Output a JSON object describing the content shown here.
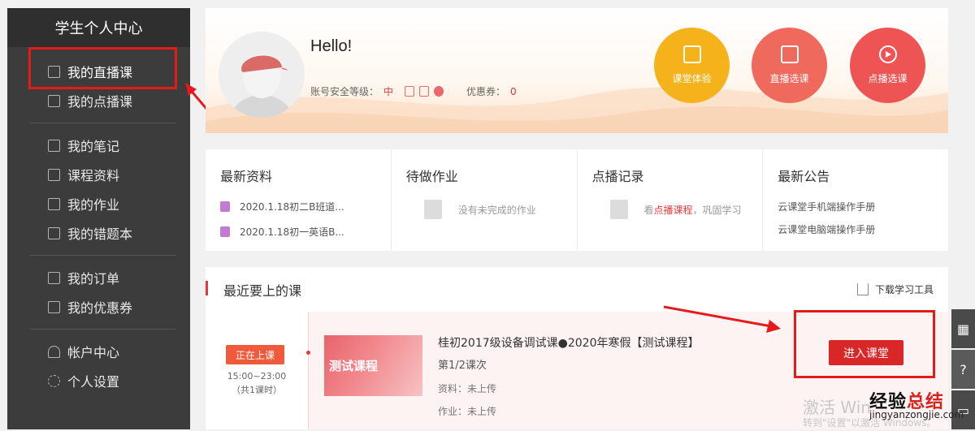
{
  "sidebar": {
    "title": "学生个人中心",
    "items": [
      {
        "label": "我的直播课",
        "icon": "calendar-icon"
      },
      {
        "label": "我的点播课",
        "icon": "video-icon"
      },
      {
        "label": "我的笔记",
        "icon": "pencil-icon"
      },
      {
        "label": "课程资料",
        "icon": "folder-icon"
      },
      {
        "label": "我的作业",
        "icon": "edit-icon"
      },
      {
        "label": "我的错题本",
        "icon": "notebook-icon"
      },
      {
        "label": "我的订单",
        "icon": "clipboard-icon"
      },
      {
        "label": "我的优惠券",
        "icon": "ticket-icon"
      },
      {
        "label": "帐户中心",
        "icon": "user-icon"
      },
      {
        "label": "个人设置",
        "icon": "gear-icon"
      }
    ]
  },
  "profile": {
    "greeting": "Hello!",
    "security_label": "账号安全等级：",
    "security_level": "中",
    "coupon_label": "优惠券：",
    "coupon_count": "0"
  },
  "quick_actions": [
    {
      "label": "课堂体验",
      "color": "#f5b21b",
      "icon": "screen-icon"
    },
    {
      "label": "直播选课",
      "color": "#f0695d",
      "icon": "checklist-icon"
    },
    {
      "label": "点播选课",
      "color": "#ee5453",
      "icon": "play-icon"
    }
  ],
  "cards": {
    "materials": {
      "title": "最新资料",
      "items": [
        "2020.1.18初二B班道...",
        "2020.1.18初一英语B..."
      ]
    },
    "homework": {
      "title": "待做作业",
      "empty": "没有未完成的作业"
    },
    "playback": {
      "title": "点播记录",
      "prefix": "看",
      "link": "点播课程",
      "suffix": "，巩固学习"
    },
    "notices": {
      "title": "最新公告",
      "items": [
        "云课堂手机端操作手册",
        "云课堂电脑端操作手册"
      ]
    }
  },
  "upcoming": {
    "title": "最近要上的课",
    "download_tool": "下载学习工具",
    "status": "正在上课",
    "time": "15:00~23:00",
    "session_count": "（共1课时）",
    "thumb_text": "测试课程",
    "course_name": "桂初2017级设备调试课●2020年寒假【测试课程】",
    "lesson": "第1/2课次",
    "material": "资料：未上传",
    "homework": "作业：未上传",
    "enter_button": "进入课堂"
  },
  "watermark": {
    "windows_line1": "激活 Win",
    "windows_line2": "转到\"设置\"以激活 Windows。",
    "site_name_black": "经验",
    "site_name_red": "总结",
    "site_url": "jingyanzongjie.com"
  },
  "colors": {
    "accent_red": "#e4393c",
    "sidebar_bg": "#3c3c3c"
  }
}
